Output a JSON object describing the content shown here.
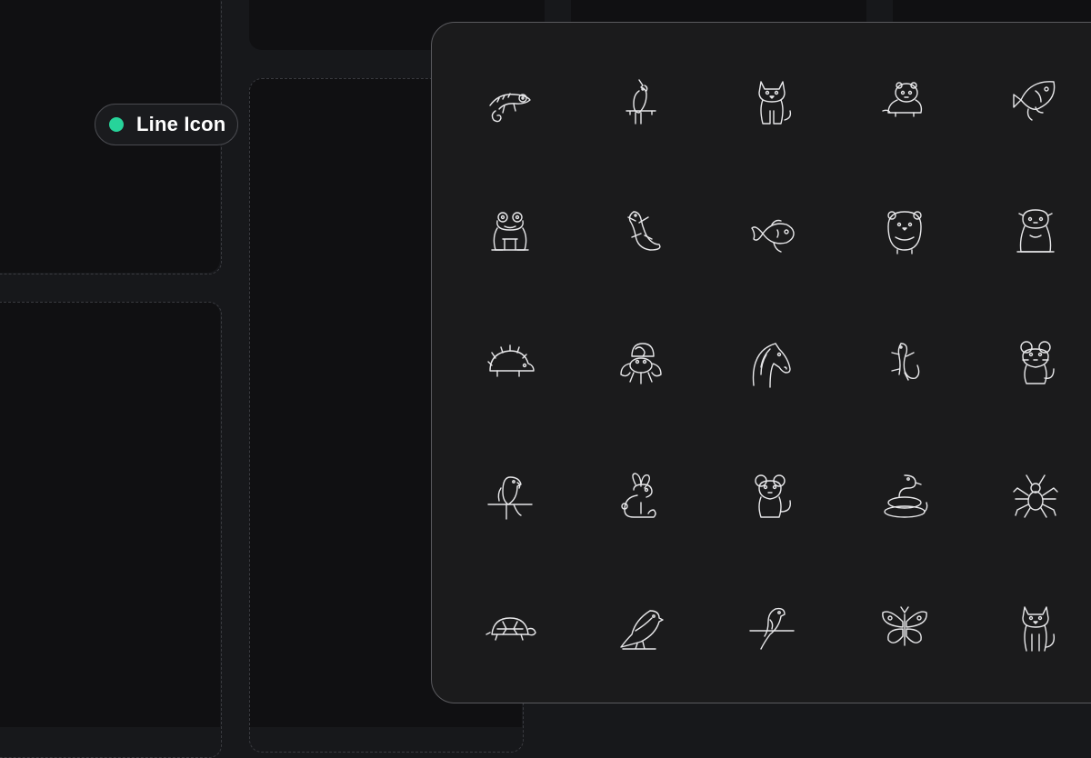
{
  "badge": {
    "label": "Line Icon",
    "dot_color": "#27d39a"
  },
  "icons": [
    "chameleon-icon",
    "cockatoo-icon",
    "cat-icon",
    "ferret-icon",
    "fish-icon",
    "frog-icon",
    "lizard-icon",
    "goldfish-icon",
    "hamster-icon",
    "guinea-pig-icon",
    "hedgehog-icon",
    "hermit-crab-icon",
    "horse-icon",
    "gecko-icon",
    "mouse-icon",
    "parrot-icon",
    "rabbit-icon",
    "rat-icon",
    "snake-icon",
    "spider-icon",
    "turtle-icon",
    "canary-icon",
    "budgie-icon",
    "butterfly-icon",
    "kitten-icon"
  ]
}
